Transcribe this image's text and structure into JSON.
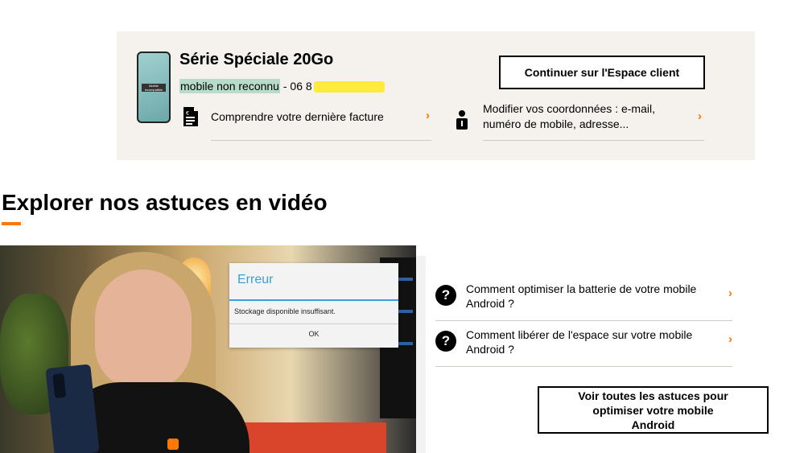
{
  "card": {
    "title": "Série Spéciale 20Go",
    "phone_screen_label": "Mobile incompatible",
    "line_status": "mobile non reconnu",
    "line_number_prefix": " - 06 8",
    "button_label": "Continuer sur l'Espace client",
    "links": [
      {
        "label": "Comprendre votre dernière facture",
        "icon": "invoice-icon"
      },
      {
        "label": "Modifier vos coordonnées : e-mail, numéro de mobile, adresse...",
        "icon": "user-info-icon"
      }
    ]
  },
  "section": {
    "title": "Explorer nos astuces en vidéo"
  },
  "video": {
    "dialog_title": "Erreur",
    "dialog_message": "Stockage disponible insuffisant.",
    "dialog_ok": "OK"
  },
  "tips": {
    "items": [
      {
        "label": "Comment optimiser la batterie de votre mobile Android ?"
      },
      {
        "label": "Comment libérer de l'espace sur votre mobile Android ?"
      }
    ],
    "button_label": "Voir toutes les astuces pour optimiser votre mobile Android"
  },
  "colors": {
    "accent": "#ff7900",
    "card_bg": "#f5f2ed",
    "highlight_green": "#b8dcc9",
    "highlight_yellow": "#ffeb3b"
  },
  "icons": [
    "chevron-right-icon",
    "question-icon",
    "invoice-icon",
    "user-info-icon"
  ]
}
